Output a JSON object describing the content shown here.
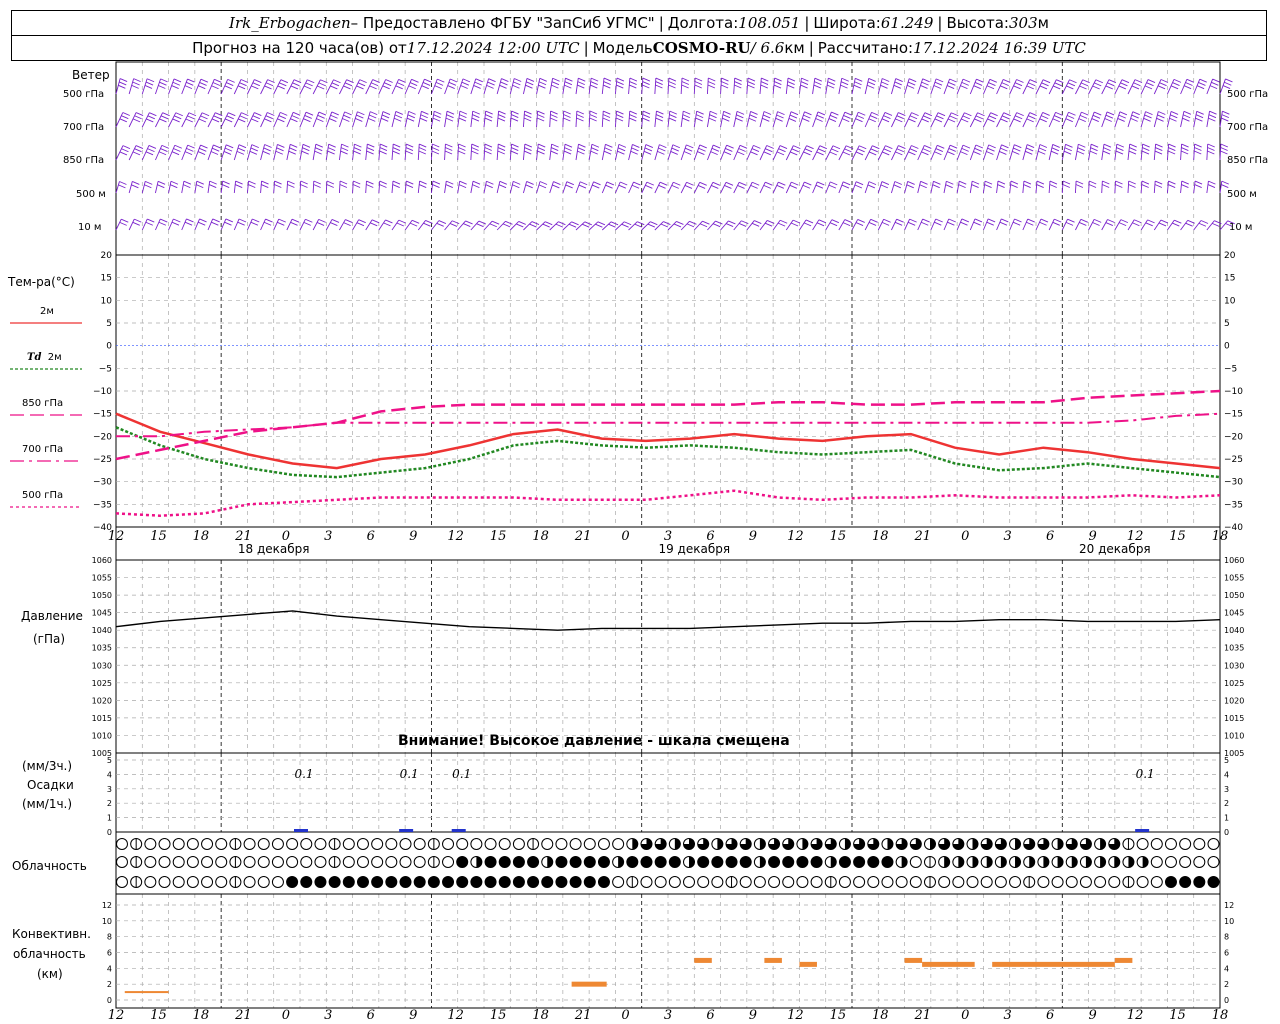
{
  "header": {
    "station": "Irk_Erbogachen",
    "provider": " – Предоставлено ФГБУ \"ЗапСиб УГМС\" ",
    "lon_label": "Долгота: ",
    "lon_value": "108.051",
    "lat_label": "Широта: ",
    "lat_value": "61.249",
    "alt_label": "Высота: ",
    "alt_value": "303",
    "alt_unit": "м",
    "forecast_prefix": "Прогноз на 120 часа(ов) от ",
    "forecast_start": "17.12.2024 12:00 UTC",
    "model_label": "Модель ",
    "model_name": "COSMO-RU",
    "model_res": " / 6.6",
    "model_res_unit": "км",
    "calc_label": "Рассчитано: ",
    "calc_time": "17.12.2024 16:39 UTC",
    "separator": "|"
  },
  "labels": {
    "wind": "Ветер",
    "levels": [
      "500 гПа",
      "700 гПа",
      "850 гПа",
      "500 м",
      "10  м"
    ],
    "temperature": "Тем-ра(°C)",
    "t2m": "2м",
    "td_prefix": "Td",
    "td2m": "2м",
    "t850": "850 гПа",
    "t700": "700 гПа",
    "t500": "500 гПа",
    "pressure_1": "Давление",
    "pressure_2": "(гПа)",
    "precip_1": "(мм/3ч.)",
    "precip_2": "Осадки",
    "precip_3": "(мм/1ч.)",
    "cloud": "Облачность",
    "conv_1": "Конвективн.",
    "conv_2": "облачность",
    "conv_3": "(км)",
    "warning": "Внимание! Высокое давление - шкала смещена"
  },
  "chart_data": {
    "type": "line",
    "x_hours_label": [
      "12",
      "15",
      "18",
      "21",
      "0",
      "3",
      "6",
      "9",
      "12",
      "15",
      "18",
      "21",
      "0",
      "3",
      "6",
      "9",
      "12",
      "15",
      "18",
      "21",
      "0",
      "3",
      "6",
      "9",
      "12",
      "15",
      "18"
    ],
    "dates": [
      "18 декабря",
      "19 декабря",
      "20 декабря"
    ],
    "temperature": {
      "ylim": [
        -40,
        20
      ],
      "ticks": [
        20,
        15,
        10,
        5,
        0,
        -5,
        -10,
        -15,
        -20,
        -25,
        -30,
        -35,
        -40
      ],
      "series": [
        {
          "name": "2м",
          "color": "#ee3333",
          "values": [
            -15,
            -19,
            -21.5,
            -24,
            -26,
            -27,
            -25,
            -24,
            -22,
            -19.5,
            -18.5,
            -20.5,
            -21,
            -20.5,
            -19.5,
            -20.5,
            -21,
            -20,
            -19.5,
            -22.5,
            -24,
            -22.5,
            -23.5,
            -25,
            -26,
            -27
          ]
        },
        {
          "name": "Td 2м",
          "color": "#228822",
          "values": [
            -18,
            -22,
            -25,
            -27,
            -28.5,
            -29,
            -28,
            -27,
            -25,
            -22,
            -21,
            -22,
            -22.5,
            -22,
            -22.5,
            -23.5,
            -24,
            -23.5,
            -23,
            -26,
            -27.5,
            -27,
            -26,
            -27,
            -28,
            -29
          ]
        },
        {
          "name": "850 гПа",
          "color": "#ee1188",
          "values": [
            -25,
            -23,
            -21,
            -19,
            -18,
            -17,
            -14.5,
            -13.5,
            -13,
            -13,
            -13,
            -13,
            -13,
            -13,
            -13,
            -12.5,
            -12.5,
            -13,
            -13,
            -12.5,
            -12.5,
            -12.5,
            -11.5,
            -11,
            -10.5,
            -10
          ]
        },
        {
          "name": "700 гПа",
          "color": "#ee1188",
          "values": [
            -20,
            -20,
            -19,
            -18.5,
            -18,
            -17,
            -17,
            -17,
            -17,
            -17,
            -17,
            -17,
            -17,
            -17,
            -17,
            -17,
            -17,
            -17,
            -17,
            -17,
            -17,
            -17,
            -17,
            -16.5,
            -15.5,
            -15
          ]
        },
        {
          "name": "500 гПа",
          "color": "#ee1188",
          "values": [
            -37,
            -37.5,
            -37,
            -35,
            -34.5,
            -34,
            -33.5,
            -33.5,
            -33.5,
            -33.5,
            -34,
            -34,
            -34,
            -33,
            -32,
            -33.5,
            -34,
            -33.5,
            -33.5,
            -33,
            -33.5,
            -33.5,
            -33.5,
            -33,
            -33.5,
            -33
          ]
        }
      ]
    },
    "pressure": {
      "ylim": [
        1005,
        1060
      ],
      "ticks": [
        1060,
        1055,
        1050,
        1045,
        1040,
        1035,
        1030,
        1025,
        1020,
        1015,
        1010,
        1005
      ],
      "values": [
        1041,
        1042.5,
        1043.5,
        1044.5,
        1045.5,
        1044,
        1043,
        1042,
        1041,
        1040.5,
        1040,
        1040.5,
        1040.5,
        1040.5,
        1041,
        1041.5,
        1042,
        1042,
        1042.5,
        1042.5,
        1043,
        1043,
        1042.5,
        1042.5,
        1042.5,
        1043
      ]
    },
    "precipitation": {
      "ylim": [
        0,
        5
      ],
      "ticks": [
        5,
        4,
        3,
        2,
        1,
        0
      ],
      "labels": [
        {
          "hour": 21,
          "text": "0.1"
        },
        {
          "hour": 33,
          "text": "0.1"
        },
        {
          "hour": 39,
          "text": "0.1"
        },
        {
          "hour": 117,
          "text": "0.1"
        }
      ]
    },
    "convective": {
      "ylim": [
        0,
        12
      ],
      "ticks": [
        12,
        10,
        8,
        6,
        4,
        2,
        0
      ],
      "bars": [
        {
          "start": 0.5,
          "end": 3,
          "top": 1
        },
        {
          "start": 26,
          "end": 28,
          "top": 2
        },
        {
          "start": 33,
          "end": 34,
          "top": 5
        },
        {
          "start": 37,
          "end": 38,
          "top": 5
        },
        {
          "start": 39,
          "end": 40,
          "top": 4.5
        },
        {
          "start": 45,
          "end": 46,
          "top": 5
        },
        {
          "start": 46,
          "end": 49,
          "top": 4.5
        },
        {
          "start": 50,
          "end": 57,
          "top": 4.5
        },
        {
          "start": 57,
          "end": 58,
          "top": 5
        }
      ]
    }
  }
}
